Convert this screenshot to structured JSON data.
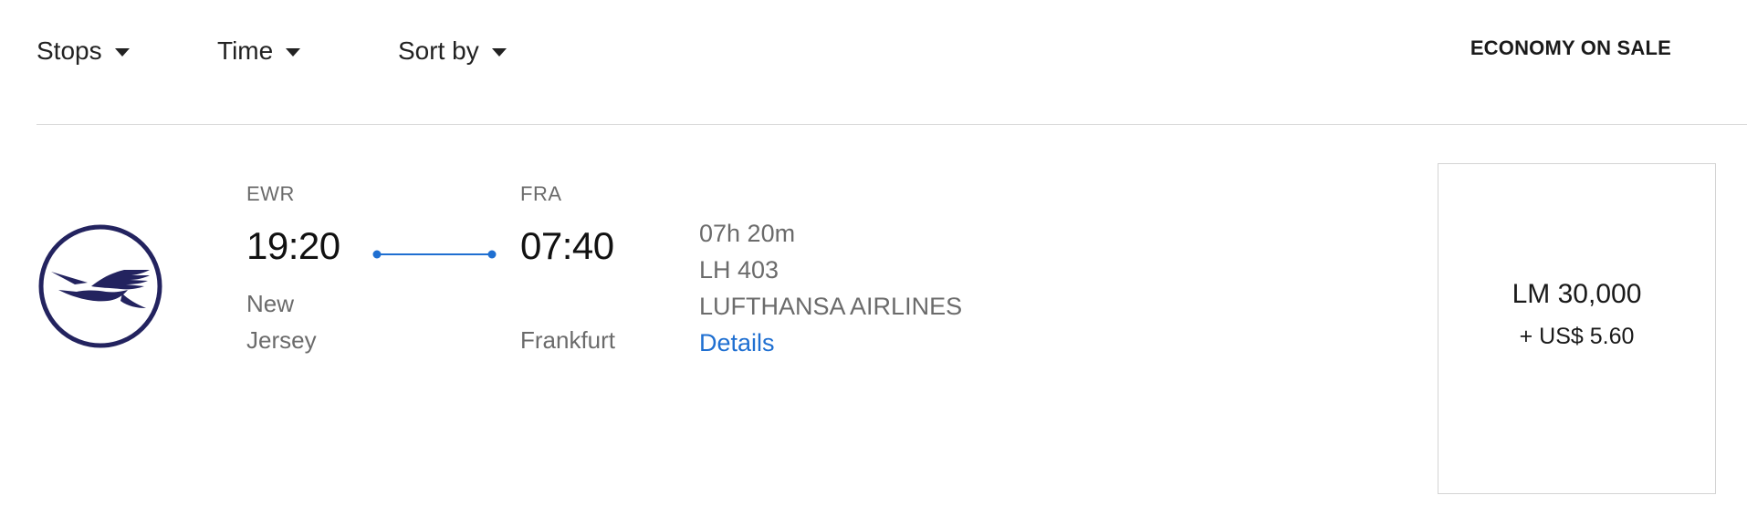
{
  "filters": {
    "stops_label": "Stops",
    "time_label": "Time",
    "sort_label": "Sort by"
  },
  "cabin_label": "ECONOMY ON SALE",
  "flight": {
    "airline_logo": "lufthansa-crane-logo",
    "departure": {
      "code": "EWR",
      "time": "19:20",
      "city": "New Jersey"
    },
    "arrival": {
      "code": "FRA",
      "time": "07:40",
      "city": "Frankfurt"
    },
    "duration": "07h 20m",
    "flight_number": "LH 403",
    "airline": "LUFTHANSA AIRLINES",
    "details_label": "Details"
  },
  "fare": {
    "miles": "LM 30,000",
    "cash": "+ US$ 5.60"
  },
  "colors": {
    "accent": "#1f6fd1",
    "logo": "#23235f",
    "text_muted": "#6b6b6b",
    "divider": "#d9d9d9"
  }
}
